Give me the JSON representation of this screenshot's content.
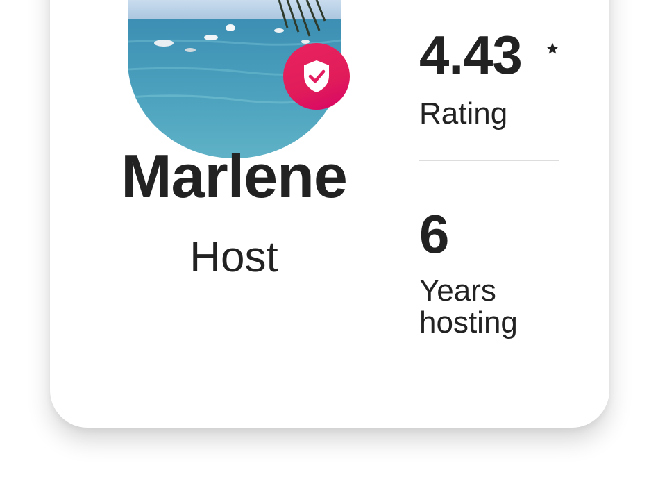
{
  "host": {
    "name": "Marlene",
    "role": "Host",
    "verified_badge_icon": "shield-check-icon",
    "avatar_image": "profile-photo-sea-and-boats"
  },
  "stats": [
    {
      "value": "4.43",
      "label": "Rating",
      "icon": "star-icon"
    },
    {
      "value": "6",
      "label": "Years hosting"
    }
  ],
  "colors": {
    "badge": "#E31C5F",
    "text": "#222222",
    "divider": "#DDDDDD",
    "background": "#FFFFFF"
  }
}
